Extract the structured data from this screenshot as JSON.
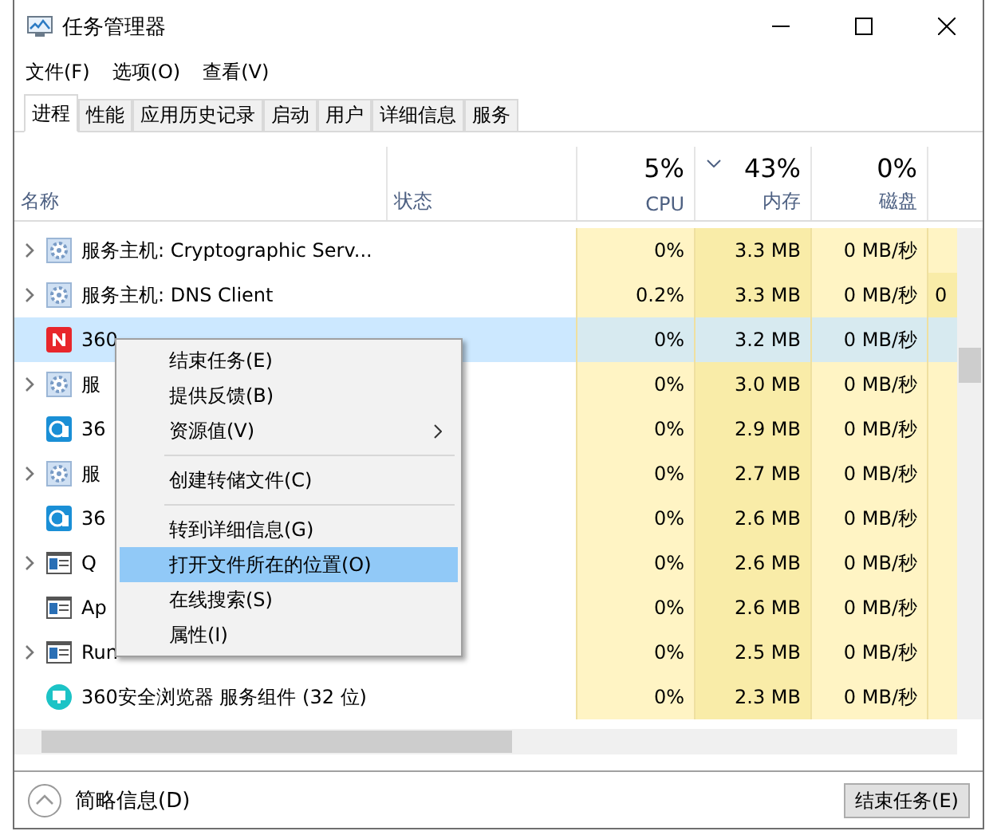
{
  "window": {
    "title": "任务管理器"
  },
  "menu": [
    "文件(F)",
    "选项(O)",
    "查看(V)"
  ],
  "tabs": [
    {
      "label": "进程",
      "selected": true
    },
    {
      "label": "性能",
      "selected": false
    },
    {
      "label": "应用历史记录",
      "selected": false
    },
    {
      "label": "启动",
      "selected": false
    },
    {
      "label": "用户",
      "selected": false
    },
    {
      "label": "详细信息",
      "selected": false
    },
    {
      "label": "服务",
      "selected": false
    }
  ],
  "columns": [
    {
      "label": "名称"
    },
    {
      "label": "状态"
    },
    {
      "label": "CPU",
      "usage": "5%",
      "sorted": false
    },
    {
      "label": "内存",
      "usage": "43%",
      "sorted": true
    },
    {
      "label": "磁盘",
      "usage": "0%",
      "sorted": false
    }
  ],
  "rows": [
    {
      "name": "服务主机: Cryptographic Serv...",
      "kind": "gear",
      "expandable": true,
      "selected": false,
      "cpu": "0%",
      "memory": "3.3 MB",
      "disk": "0 MB/秒"
    },
    {
      "name": "服务主机: DNS Client",
      "kind": "gear",
      "expandable": true,
      "selected": false,
      "cpu": "0.2%",
      "memory": "3.3 MB",
      "disk": "0 MB/秒",
      "column_5": "0"
    },
    {
      "name": "360",
      "kind": "red",
      "expandable": false,
      "selected": true,
      "cpu": "0%",
      "memory": "3.2 MB",
      "disk": "0 MB/秒"
    },
    {
      "name": "服",
      "kind": "gear",
      "expandable": true,
      "selected": false,
      "cpu": "0%",
      "memory": "3.0 MB",
      "disk": "0 MB/秒"
    },
    {
      "name": "36",
      "kind": "browser",
      "expandable": false,
      "selected": false,
      "cpu": "0%",
      "memory": "2.9 MB",
      "disk": "0 MB/秒"
    },
    {
      "name": "服",
      "kind": "gear",
      "expandable": true,
      "selected": false,
      "cpu": "0%",
      "memory": "2.7 MB",
      "disk": "0 MB/秒"
    },
    {
      "name": "36",
      "kind": "browser",
      "expandable": false,
      "selected": false,
      "cpu": "0%",
      "memory": "2.6 MB",
      "disk": "0 MB/秒"
    },
    {
      "name": "Q",
      "kind": "window",
      "expandable": true,
      "selected": false,
      "cpu": "0%",
      "memory": "2.6 MB",
      "disk": "0 MB/秒"
    },
    {
      "name": "Ap",
      "kind": "window",
      "expandable": false,
      "selected": false,
      "cpu": "0%",
      "memory": "2.6 MB",
      "disk": "0 MB/秒"
    },
    {
      "name": "Run",
      "kind": "window",
      "expandable": true,
      "selected": false,
      "cpu": "0%",
      "memory": "2.5 MB",
      "disk": "0 MB/秒"
    },
    {
      "name": "360安全浏览器 服务组件 (32 位)",
      "kind": "monitor",
      "expandable": false,
      "selected": false,
      "cpu": "0%",
      "memory": "2.3 MB",
      "disk": "0 MB/秒"
    }
  ],
  "context_menu": [
    {
      "kind": "item",
      "label": "结束任务(E)",
      "selected": false,
      "submenu": false
    },
    {
      "kind": "item",
      "label": "提供反馈(B)",
      "selected": false,
      "submenu": false
    },
    {
      "kind": "item",
      "label": "资源值(V)",
      "selected": false,
      "submenu": true
    },
    {
      "kind": "separator"
    },
    {
      "kind": "item",
      "label": "创建转储文件(C)",
      "selected": false,
      "submenu": false
    },
    {
      "kind": "separator"
    },
    {
      "kind": "item",
      "label": "转到详细信息(G)",
      "selected": false,
      "submenu": false
    },
    {
      "kind": "item",
      "label": "打开文件所在的位置(O)",
      "selected": true,
      "submenu": false
    },
    {
      "kind": "item",
      "label": "在线搜索(S)",
      "selected": false,
      "submenu": false
    },
    {
      "kind": "item",
      "label": "属性(I)",
      "selected": false,
      "submenu": false
    }
  ],
  "footer": {
    "details_toggle": "简略信息(D)",
    "end_task": "结束任务(E)"
  }
}
